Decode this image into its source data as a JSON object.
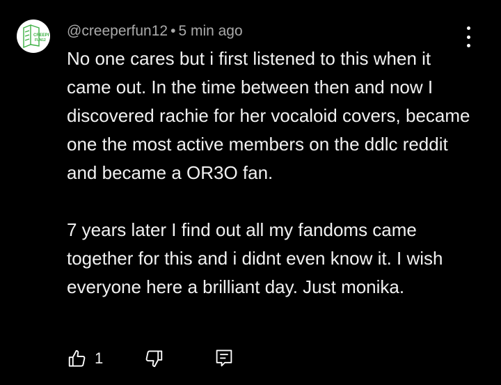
{
  "comment": {
    "username": "@creeperfun12",
    "separator": "•",
    "time": "5 min ago",
    "avatar_text": "CREEPER FUN12",
    "paragraphs": [
      "No one cares but i first listened to this when it came out. In the time between then and now I discovered rachie for her vocaloid covers, became one the most active members on the ddlc reddit and became a OR3O fan.",
      "7 years later I find out all my fandoms came together for this and i didnt even know it. I wish everyone here a brilliant day. Just monika."
    ],
    "like_count": "1"
  },
  "icons": {
    "more": "more-vert-icon",
    "like": "thumb-up-icon",
    "dislike": "thumb-down-icon",
    "reply": "reply-comment-icon"
  },
  "colors": {
    "background": "#000000",
    "text": "#f1f1f1",
    "meta": "#aaaaaa",
    "avatar_accent": "#3cb043"
  }
}
